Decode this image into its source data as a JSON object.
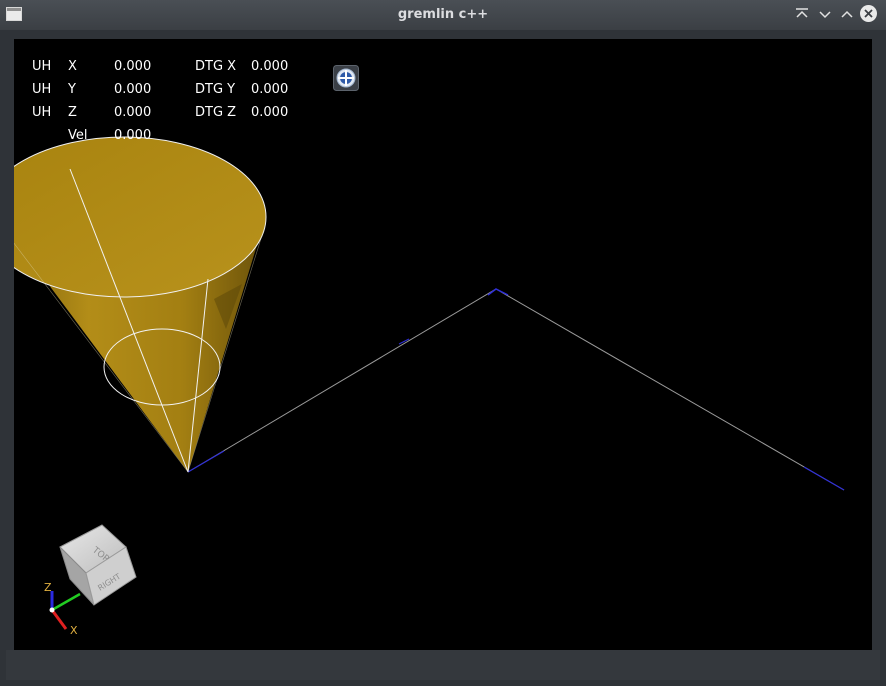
{
  "window": {
    "title": "gremlin c++"
  },
  "dro": {
    "rows": [
      {
        "prefix": "UH",
        "axis": "X",
        "value": "0.000",
        "dtg_label": "DTG X",
        "dtg_value": "0.000"
      },
      {
        "prefix": "UH",
        "axis": "Y",
        "value": "0.000",
        "dtg_label": "DTG Y",
        "dtg_value": "0.000"
      },
      {
        "prefix": "UH",
        "axis": "Z",
        "value": "0.000",
        "dtg_label": "DTG Z",
        "dtg_value": "0.000"
      }
    ],
    "vel_label": "Vel",
    "vel_value": "0.000"
  },
  "view_cube": {
    "top_label": "TOP",
    "right_label": "RIGHT"
  },
  "axes_triad": {
    "z_label": "Z",
    "x_label": "X"
  },
  "colors": {
    "cone": "#b08a16",
    "toolpath": "#3030d0",
    "background": "#000000"
  },
  "icons": [
    "app-icon",
    "minimize-icon",
    "maximize-icon",
    "shade-icon",
    "close-icon",
    "zoom-fit-icon"
  ]
}
